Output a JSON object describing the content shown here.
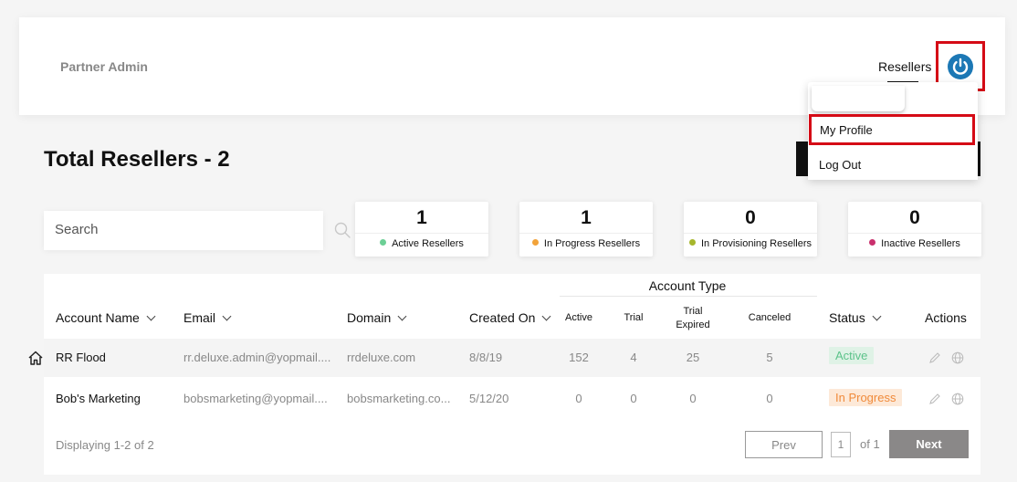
{
  "header": {
    "brand": "Partner Admin",
    "nav_resellers": "Resellers",
    "power_icon": "power-icon",
    "accent_color": "#1c78b5",
    "highlight_color": "#d50b16"
  },
  "user_menu": {
    "items": [
      "My Profile",
      "Log Out"
    ]
  },
  "page": {
    "title": "Total Resellers - 2"
  },
  "search": {
    "placeholder": "Search",
    "icon": "search-icon"
  },
  "stats": [
    {
      "count": "1",
      "label": "Active Resellers",
      "dot_color": "#6ccf95"
    },
    {
      "count": "1",
      "label": "In Progress Resellers",
      "dot_color": "#f2a33a"
    },
    {
      "count": "0",
      "label": "In Provisioning Resellers",
      "dot_color": "#a6b62c"
    },
    {
      "count": "0",
      "label": "Inactive Resellers",
      "dot_color": "#c9306d"
    }
  ],
  "table": {
    "group_header": "Account Type",
    "columns": {
      "account_name": "Account Name",
      "email": "Email",
      "domain": "Domain",
      "created_on": "Created On",
      "active": "Active",
      "trial": "Trial",
      "trial_expired_1": "Trial",
      "trial_expired_2": "Expired",
      "canceled": "Canceled",
      "status": "Status",
      "actions": "Actions"
    },
    "rows": [
      {
        "name": "RR Flood",
        "email": "rr.deluxe.admin@yopmail....",
        "domain": "rrdeluxe.com",
        "created": "8/8/19",
        "active": "152",
        "trial": "4",
        "trial_expired": "25",
        "canceled": "5",
        "status": "Active"
      },
      {
        "name": "Bob's Marketing",
        "email": "bobsmarketing@yopmail....",
        "domain": "bobsmarketing.co...",
        "created": "5/12/20",
        "active": "0",
        "trial": "0",
        "trial_expired": "0",
        "canceled": "0",
        "status": "In Progress"
      }
    ]
  },
  "pagination": {
    "summary": "Displaying 1-2 of 2",
    "prev": "Prev",
    "page": "1",
    "of": "of 1",
    "next": "Next"
  }
}
